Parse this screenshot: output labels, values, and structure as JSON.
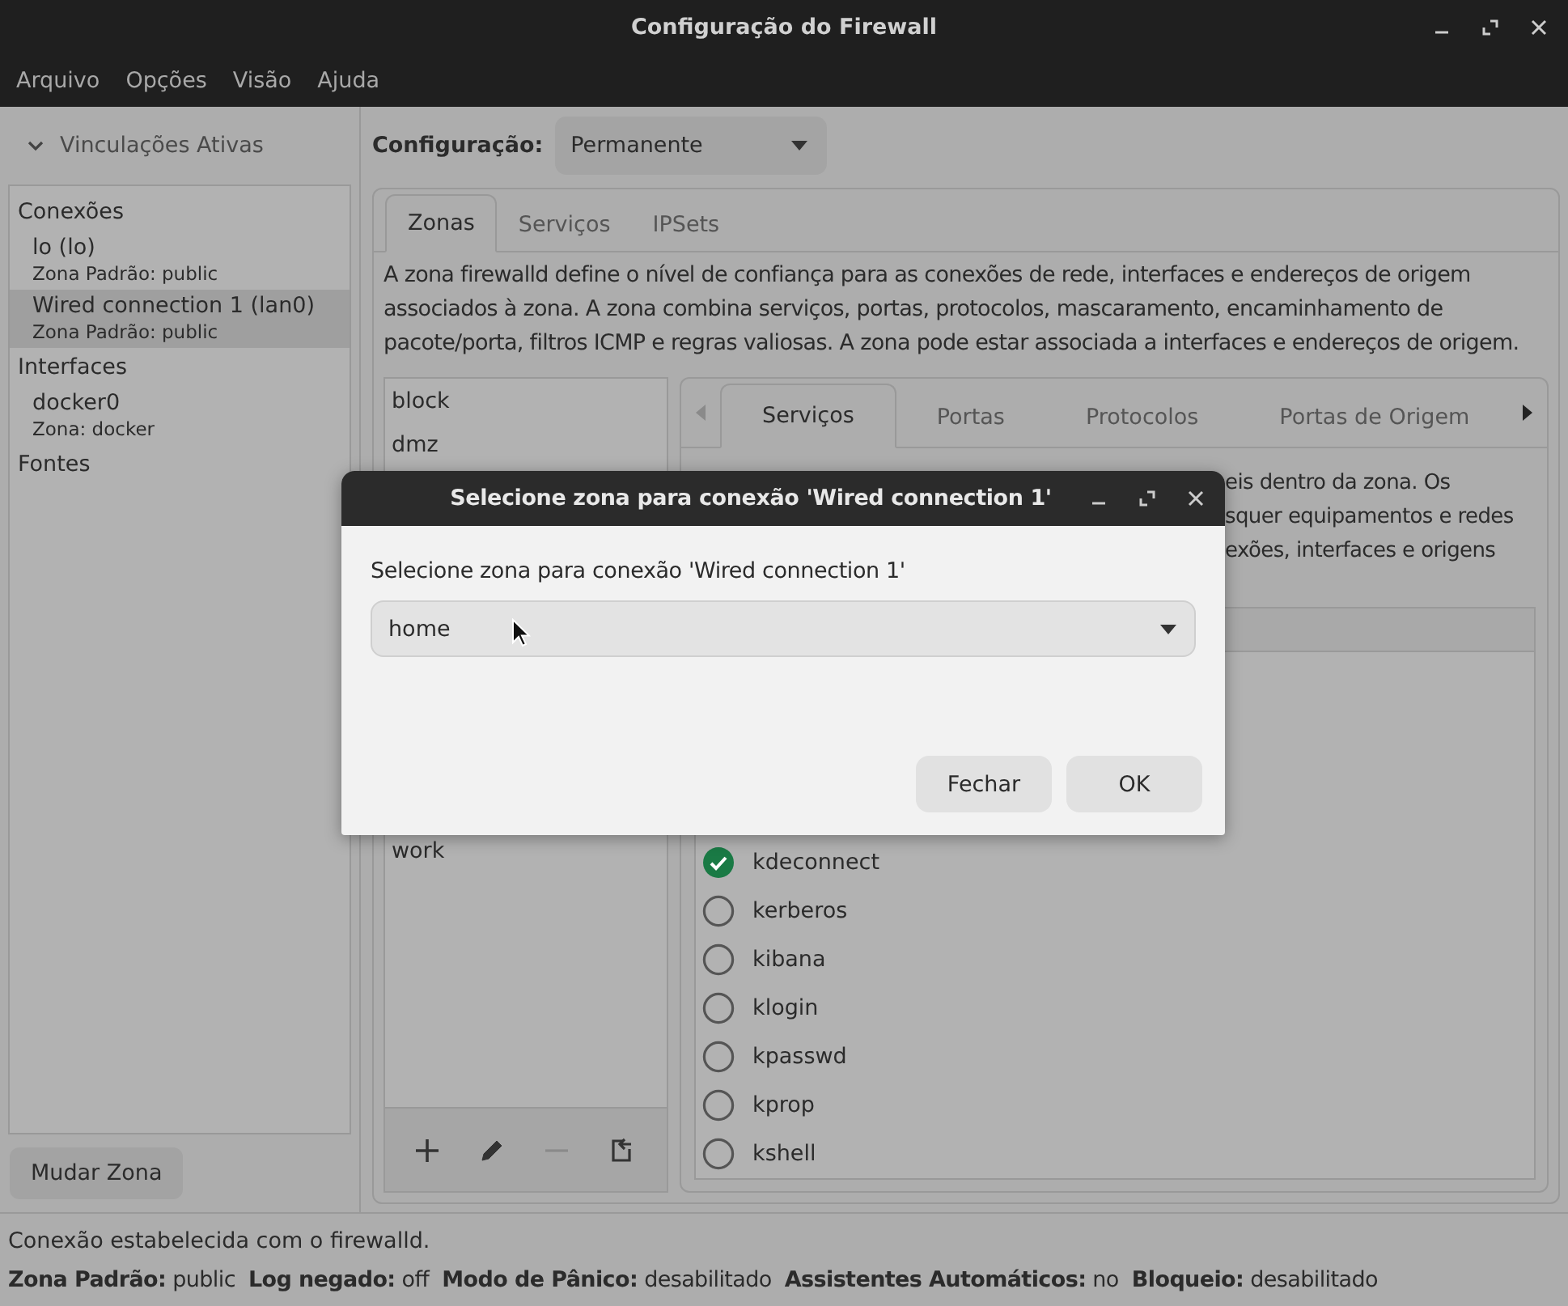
{
  "window": {
    "title": "Configuração do Firewall"
  },
  "menu": [
    "Arquivo",
    "Opções",
    "Visão",
    "Ajuda"
  ],
  "sidebar": {
    "header": "Vinculações Ativas",
    "expanded": true,
    "groups": [
      {
        "label": "Conexões",
        "items": [
          {
            "name": "lo (lo)",
            "detail": "Zona Padrão: public",
            "selected": false
          },
          {
            "name": "Wired connection 1 (lan0)",
            "detail": "Zona Padrão: public",
            "selected": true
          }
        ]
      },
      {
        "label": "Interfaces",
        "items": [
          {
            "name": "docker0",
            "detail": "Zona: docker",
            "selected": false
          }
        ]
      },
      {
        "label": "Fontes"
      }
    ],
    "button": "Mudar Zona"
  },
  "configuration": {
    "label": "Configuração:",
    "value": "Permanente"
  },
  "tabs": [
    {
      "label": "Zonas",
      "selected": true
    },
    {
      "label": "Serviços",
      "selected": false
    },
    {
      "label": "IPSets",
      "selected": false
    }
  ],
  "zones": {
    "description": "A zona firewalld define o nível de confiança para as conexões de rede, interfaces e endereços de origem associados à zona. A zona combina serviços, portas, protocolos, mascaramento, encaminhamento de pacote/porta, filtros ICMP e regras valiosas. A zona pode estar associada a interfaces e endereços de origem.",
    "top_items": [
      "block",
      "dmz"
    ],
    "bottom_items": [
      "work"
    ],
    "toolbar": [
      {
        "kind": "add",
        "disabled": false
      },
      {
        "kind": "edit",
        "disabled": false
      },
      {
        "kind": "remove",
        "disabled": true
      },
      {
        "kind": "load",
        "disabled": false
      }
    ]
  },
  "zone_tabs": [
    {
      "label": "Serviços",
      "selected": true
    },
    {
      "label": "Portas",
      "selected": false
    },
    {
      "label": "Protocolos",
      "selected": false
    },
    {
      "label": "Portas de Origem",
      "selected": false
    }
  ],
  "services_description": [
    "eis dentro da zona. Os",
    "squer equipamentos e redes",
    "exões, interfaces e origens"
  ],
  "services": [
    {
      "name": "kdeconnect",
      "checked": true
    },
    {
      "name": "kerberos",
      "checked": false
    },
    {
      "name": "kibana",
      "checked": false
    },
    {
      "name": "klogin",
      "checked": false
    },
    {
      "name": "kpasswd",
      "checked": false
    },
    {
      "name": "kprop",
      "checked": false
    },
    {
      "name": "kshell",
      "checked": false
    }
  ],
  "dialog": {
    "title": "Selecione zona para conexão 'Wired connection 1'",
    "label": "Selecione zona para conexão 'Wired connection 1'",
    "value": "home",
    "buttons": [
      "Fechar",
      "OK"
    ]
  },
  "status": {
    "message": "Conexão estabelecida com o firewalld.",
    "fields": [
      {
        "label": "Zona Padrão:",
        "value": "public"
      },
      {
        "label": "Log negado:",
        "value": "off"
      },
      {
        "label": "Modo de Pânico:",
        "value": "desabilitado"
      },
      {
        "label": "Assistentes Automáticos:",
        "value": "no"
      },
      {
        "label": "Bloqueio:",
        "value": "desabilitado"
      }
    ]
  }
}
